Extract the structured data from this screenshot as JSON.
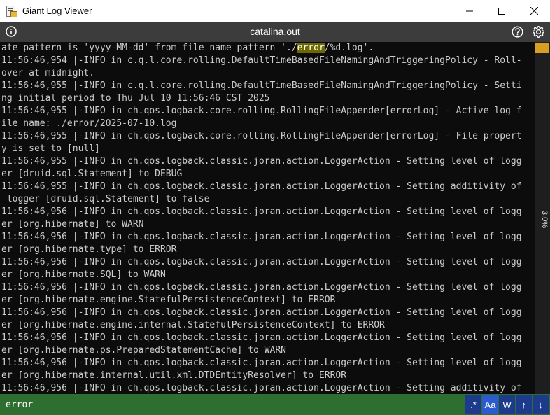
{
  "window": {
    "title": "Giant Log Viewer"
  },
  "header": {
    "file_name": "catalina.out"
  },
  "log": {
    "lines": [
      "ate pattern is 'yyyy-MM-dd' from file name pattern './error/%d.log'.",
      "11:56:46,954 |-INFO in c.q.l.core.rolling.DefaultTimeBasedFileNamingAndTriggeringPolicy - Roll-",
      "over at midnight.",
      "11:56:46,955 |-INFO in c.q.l.core.rolling.DefaultTimeBasedFileNamingAndTriggeringPolicy - Setti",
      "ng initial period to Thu Jul 10 11:56:46 CST 2025",
      "11:56:46,955 |-INFO in ch.qos.logback.core.rolling.RollingFileAppender[errorLog] - Active log f",
      "ile name: ./error/2025-07-10.log",
      "11:56:46,955 |-INFO in ch.qos.logback.core.rolling.RollingFileAppender[errorLog] - File propert",
      "y is set to [null]",
      "11:56:46,955 |-INFO in ch.qos.logback.classic.joran.action.LoggerAction - Setting level of logg",
      "er [druid.sql.Statement] to DEBUG",
      "11:56:46,955 |-INFO in ch.qos.logback.classic.joran.action.LoggerAction - Setting additivity of",
      " logger [druid.sql.Statement] to false",
      "11:56:46,956 |-INFO in ch.qos.logback.classic.joran.action.LoggerAction - Setting level of logg",
      "er [org.hibernate] to WARN",
      "11:56:46,956 |-INFO in ch.qos.logback.classic.joran.action.LoggerAction - Setting level of logg",
      "er [org.hibernate.type] to ERROR",
      "11:56:46,956 |-INFO in ch.qos.logback.classic.joran.action.LoggerAction - Setting level of logg",
      "er [org.hibernate.SQL] to WARN",
      "11:56:46,956 |-INFO in ch.qos.logback.classic.joran.action.LoggerAction - Setting level of logg",
      "er [org.hibernate.engine.StatefulPersistenceContext] to ERROR",
      "11:56:46,956 |-INFO in ch.qos.logback.classic.joran.action.LoggerAction - Setting level of logg",
      "er [org.hibernate.engine.internal.StatefulPersistenceContext] to ERROR",
      "11:56:46,956 |-INFO in ch.qos.logback.classic.joran.action.LoggerAction - Setting level of logg",
      "er [org.hibernate.ps.PreparedStatementCache] to WARN",
      "11:56:46,956 |-INFO in ch.qos.logback.classic.joran.action.LoggerAction - Setting level of logg",
      "er [org.hibernate.internal.util.xml.DTDEntityResolver] to ERROR",
      "11:56:46,956 |-INFO in ch.qos.logback.classic.joran.action.LoggerAction - Setting additivity of"
    ],
    "first_line_parts": {
      "before": "ate pattern is 'yyyy-MM-dd' from file name pattern './",
      "match": "error",
      "after": "/%d.log'."
    },
    "highlight_color": "#6e6800"
  },
  "scroll": {
    "position_percent": "3.0%",
    "thumb_color": "#d89f22"
  },
  "search": {
    "value": "error",
    "buttons": {
      "regex": ".*",
      "match_case": "Aa",
      "whole_word": "W",
      "prev": "↑",
      "next": "↓"
    }
  },
  "colors": {
    "search_bar": "#2e6f31",
    "header": "#3c3c3c",
    "log_background": "#0c0c0c"
  },
  "icons": {
    "app": "log-file-icon",
    "info": "info-icon",
    "help": "help-icon",
    "settings": "gear-icon",
    "minimize": "minimize-icon",
    "maximize": "maximize-icon",
    "close": "close-icon"
  }
}
